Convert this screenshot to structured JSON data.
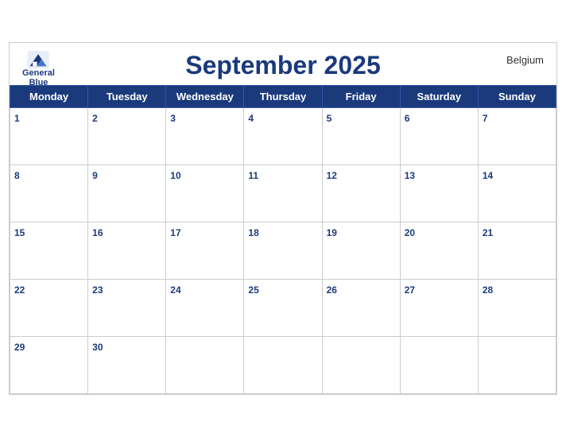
{
  "header": {
    "title": "September 2025",
    "country": "Belgium",
    "logo_general": "General",
    "logo_blue": "Blue"
  },
  "days": [
    "Monday",
    "Tuesday",
    "Wednesday",
    "Thursday",
    "Friday",
    "Saturday",
    "Sunday"
  ],
  "weeks": [
    [
      1,
      2,
      3,
      4,
      5,
      6,
      7
    ],
    [
      8,
      9,
      10,
      11,
      12,
      13,
      14
    ],
    [
      15,
      16,
      17,
      18,
      19,
      20,
      21
    ],
    [
      22,
      23,
      24,
      25,
      26,
      27,
      28
    ],
    [
      29,
      30,
      null,
      null,
      null,
      null,
      null
    ]
  ],
  "colors": {
    "header_bg": "#1a3a7c",
    "header_text": "#ffffff",
    "title_color": "#1a3a7c",
    "date_color": "#1a3a7c"
  }
}
